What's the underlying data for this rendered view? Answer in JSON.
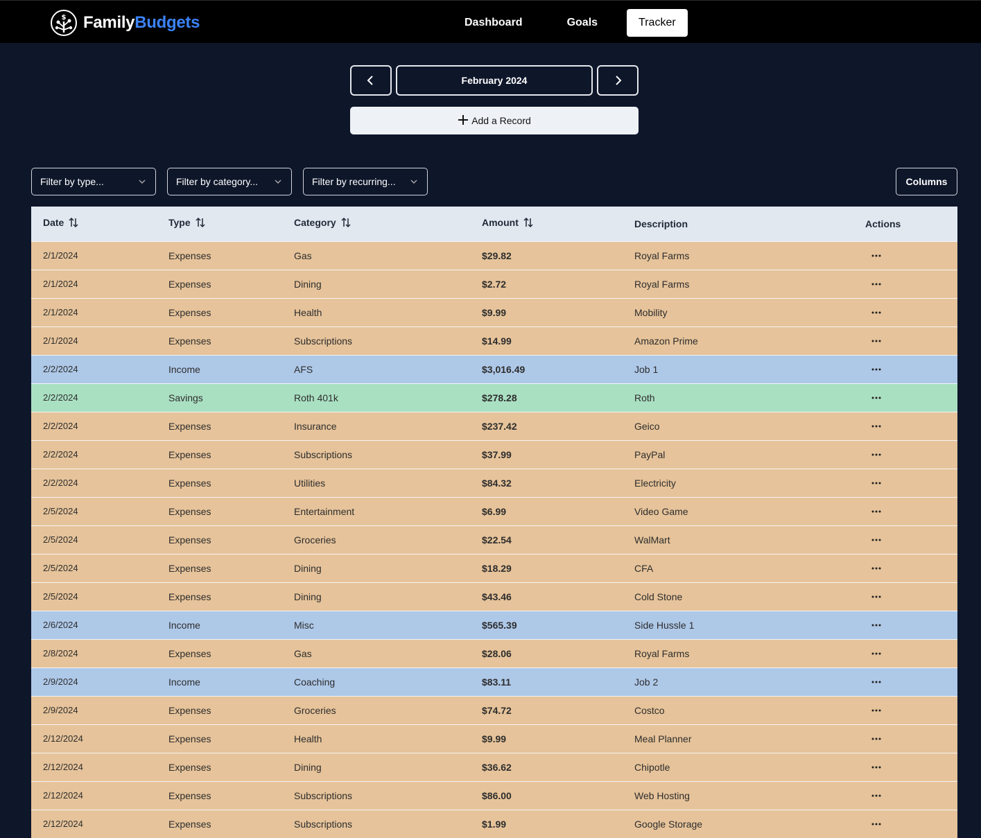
{
  "brand": {
    "name_part1": "Family",
    "name_part2": "Budgets"
  },
  "nav": {
    "dashboard": "Dashboard",
    "goals": "Goals",
    "tracker": "Tracker"
  },
  "month": {
    "label": "February 2024"
  },
  "add_record_label": "Add a Record",
  "filters": {
    "type": "Filter by type...",
    "category": "Filter by category...",
    "recurring": "Filter by recurring..."
  },
  "columns_label": "Columns",
  "table": {
    "headers": {
      "date": "Date",
      "type": "Type",
      "category": "Category",
      "amount": "Amount",
      "description": "Description",
      "actions": "Actions"
    },
    "rows": [
      {
        "date": "2/1/2024",
        "type": "Expenses",
        "category": "Gas",
        "amount": "$29.82",
        "description": "Royal Farms"
      },
      {
        "date": "2/1/2024",
        "type": "Expenses",
        "category": "Dining",
        "amount": "$2.72",
        "description": "Royal Farms"
      },
      {
        "date": "2/1/2024",
        "type": "Expenses",
        "category": "Health",
        "amount": "$9.99",
        "description": "Mobility"
      },
      {
        "date": "2/1/2024",
        "type": "Expenses",
        "category": "Subscriptions",
        "amount": "$14.99",
        "description": "Amazon Prime"
      },
      {
        "date": "2/2/2024",
        "type": "Income",
        "category": "AFS",
        "amount": "$3,016.49",
        "description": "Job 1"
      },
      {
        "date": "2/2/2024",
        "type": "Savings",
        "category": "Roth 401k",
        "amount": "$278.28",
        "description": "Roth"
      },
      {
        "date": "2/2/2024",
        "type": "Expenses",
        "category": "Insurance",
        "amount": "$237.42",
        "description": "Geico"
      },
      {
        "date": "2/2/2024",
        "type": "Expenses",
        "category": "Subscriptions",
        "amount": "$37.99",
        "description": "PayPal"
      },
      {
        "date": "2/2/2024",
        "type": "Expenses",
        "category": "Utilities",
        "amount": "$84.32",
        "description": "Electricity"
      },
      {
        "date": "2/5/2024",
        "type": "Expenses",
        "category": "Entertainment",
        "amount": "$6.99",
        "description": "Video Game"
      },
      {
        "date": "2/5/2024",
        "type": "Expenses",
        "category": "Groceries",
        "amount": "$22.54",
        "description": "WalMart"
      },
      {
        "date": "2/5/2024",
        "type": "Expenses",
        "category": "Dining",
        "amount": "$18.29",
        "description": "CFA"
      },
      {
        "date": "2/5/2024",
        "type": "Expenses",
        "category": "Dining",
        "amount": "$43.46",
        "description": "Cold Stone"
      },
      {
        "date": "2/6/2024",
        "type": "Income",
        "category": "Misc",
        "amount": "$565.39",
        "description": "Side Hussle 1"
      },
      {
        "date": "2/8/2024",
        "type": "Expenses",
        "category": "Gas",
        "amount": "$28.06",
        "description": "Royal Farms"
      },
      {
        "date": "2/9/2024",
        "type": "Income",
        "category": "Coaching",
        "amount": "$83.11",
        "description": "Job 2"
      },
      {
        "date": "2/9/2024",
        "type": "Expenses",
        "category": "Groceries",
        "amount": "$74.72",
        "description": "Costco"
      },
      {
        "date": "2/12/2024",
        "type": "Expenses",
        "category": "Health",
        "amount": "$9.99",
        "description": "Meal Planner"
      },
      {
        "date": "2/12/2024",
        "type": "Expenses",
        "category": "Dining",
        "amount": "$36.62",
        "description": "Chipotle"
      },
      {
        "date": "2/12/2024",
        "type": "Expenses",
        "category": "Subscriptions",
        "amount": "$86.00",
        "description": "Web Hosting"
      },
      {
        "date": "2/12/2024",
        "type": "Expenses",
        "category": "Subscriptions",
        "amount": "$1.99",
        "description": "Google Storage"
      }
    ]
  },
  "colors": {
    "background": "#0e162a",
    "brand_accent": "#3b82f6",
    "expenses_row": "#e6c39a",
    "income_row": "#aec8e8",
    "savings_row": "#aae0c2",
    "header_row": "#e2e8f0"
  },
  "icons": [
    "logo-tree-icon",
    "chevron-left-icon",
    "chevron-right-icon",
    "plus-icon",
    "chevron-down-icon",
    "sort-icon",
    "more-horizontal-icon"
  ]
}
